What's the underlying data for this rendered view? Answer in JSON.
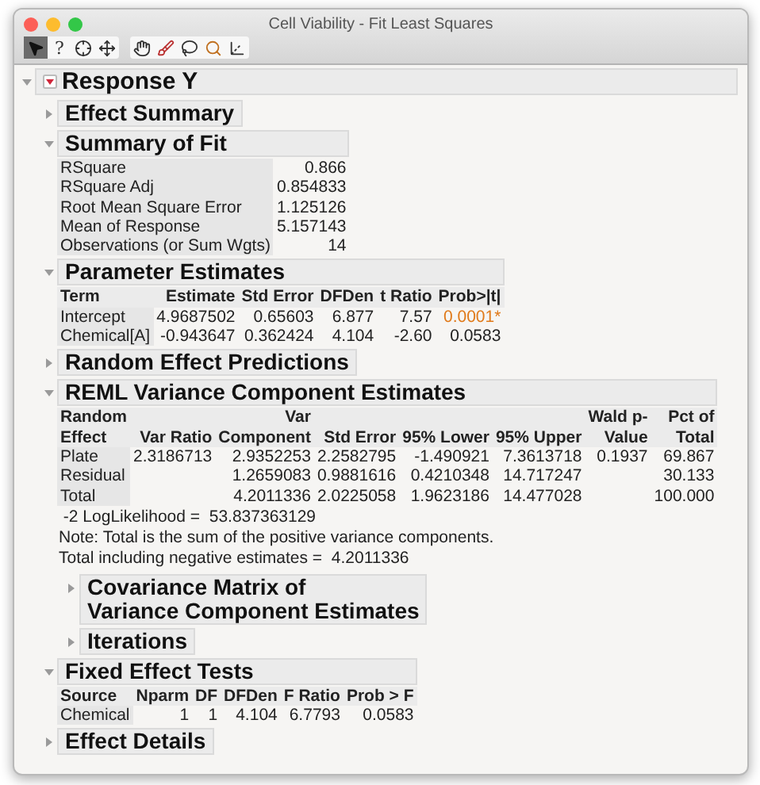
{
  "window": {
    "title": "Cell Viability - Fit Least Squares"
  },
  "toolbar": {
    "groups": [
      [
        {
          "kind": "pointer",
          "selected": true
        },
        {
          "kind": "help",
          "glyph": "?",
          "selected": false
        },
        {
          "kind": "crosshair",
          "selected": false
        },
        {
          "kind": "move",
          "selected": false
        }
      ],
      [
        {
          "kind": "hand",
          "selected": false
        },
        {
          "kind": "brush",
          "selected": false
        },
        {
          "kind": "lasso",
          "selected": false
        },
        {
          "kind": "zoom",
          "selected": false
        },
        {
          "kind": "scaler",
          "selected": false
        }
      ]
    ]
  },
  "report": {
    "title": "Response Y",
    "expanded": true,
    "sections": [
      {
        "title": "Effect Summary",
        "expanded": false
      },
      {
        "title": "Summary of Fit",
        "expanded": true,
        "table": {
          "rows": [
            {
              "cells": [
                "RSquare",
                "0.866"
              ],
              "significant": false
            },
            {
              "cells": [
                "RSquare Adj",
                "0.854833"
              ],
              "significant": false
            },
            {
              "cells": [
                "Root Mean Square Error",
                "1.125126"
              ],
              "significant": false
            },
            {
              "cells": [
                "Mean of Response",
                "5.157143"
              ],
              "significant": false
            },
            {
              "cells": [
                "Observations (or Sum Wgts)",
                "14"
              ],
              "significant": false
            }
          ]
        }
      },
      {
        "title": "Parameter Estimates",
        "expanded": true,
        "table": {
          "columns": [
            "Term",
            "Estimate",
            "Std Error",
            "DFDen",
            "t Ratio",
            "Prob>|t|"
          ],
          "rows": [
            {
              "cells": [
                "Intercept",
                "4.9687502",
                "0.65603",
                "6.877",
                "7.57",
                "0.0001*"
              ],
              "significant": true
            },
            {
              "cells": [
                "Chemical[A]",
                "-0.943647",
                "0.362424",
                "4.104",
                "-2.60",
                "0.0583"
              ],
              "significant": false
            }
          ]
        }
      },
      {
        "title": "Random Effect Predictions",
        "expanded": false
      },
      {
        "title": "REML Variance Component Estimates",
        "expanded": true,
        "table": {
          "columns": [
            "Random\nEffect",
            "Var Ratio",
            "Var\nComponent",
            "Std Error",
            "95% Lower",
            "95% Upper",
            "Wald p-\nValue",
            "Pct of\nTotal"
          ],
          "rows": [
            {
              "cells": [
                "Plate",
                "2.3186713",
                "2.9352253",
                "2.2582795",
                "-1.490921",
                "7.3613718",
                "0.1937",
                "69.867"
              ],
              "significant": false
            },
            {
              "cells": [
                "Residual",
                null,
                "1.2659083",
                "0.9881616",
                "0.4210348",
                "14.717247",
                null,
                "30.133"
              ],
              "significant": false
            },
            {
              "cells": [
                "Total",
                null,
                "4.2011336",
                "2.0225058",
                "1.9623186",
                "14.477028",
                null,
                "100.000"
              ],
              "significant": false
            }
          ]
        },
        "notes": [
          " -2 LogLikelihood =  53.837363129",
          "Note: Total is the sum of the positive variance components.",
          "Total including negative estimates =  4.2011336"
        ],
        "children": [
          {
            "title": "Covariance Matrix of\nVariance Component Estimates",
            "expanded": false
          },
          {
            "title": "Iterations",
            "expanded": false
          }
        ]
      },
      {
        "title": "Fixed Effect Tests",
        "expanded": true,
        "table": {
          "columns": [
            "Source",
            "Nparm",
            "DF",
            "DFDen",
            "F Ratio",
            "Prob > F"
          ],
          "rows": [
            {
              "cells": [
                "Chemical",
                "1",
                "1",
                "4.104",
                "6.7793",
                "0.0583"
              ],
              "significant": false
            }
          ]
        }
      },
      {
        "title": "Effect Details",
        "expanded": false
      }
    ]
  }
}
